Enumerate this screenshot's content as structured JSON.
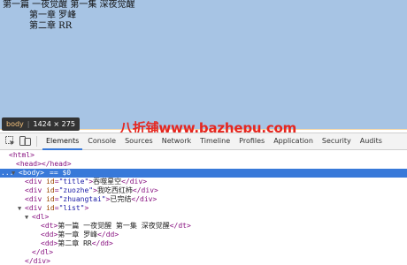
{
  "preview": {
    "dt_text": "第一篇 一夜觉醒 第一集 深夜觉醒",
    "dd_items": [
      "第一章 罗峰",
      "第二章 RR"
    ],
    "tooltip_tag": "body",
    "tooltip_size": "1424 × 275",
    "watermark": "八折铺www.bazhepu.com"
  },
  "toolbar": {
    "tabs": [
      "Elements",
      "Console",
      "Sources",
      "Network",
      "Timeline",
      "Profiles",
      "Application",
      "Security",
      "Audits"
    ],
    "active_tab": "Elements"
  },
  "dom": {
    "html_open": "<html>",
    "head": "<head></head>",
    "body_gutter": "...",
    "body_open": "<body>",
    "body_marker": "== $0",
    "div1_attr": "id",
    "div1_val": "\"title\"",
    "div1_text": "吞噬星空",
    "div2_attr": "id",
    "div2_val": "\"zuozhe\"",
    "div2_text": "我吃西红柿",
    "div3_attr": "id",
    "div3_val": "\"zhuangtai\"",
    "div3_text": "已完结",
    "div4_attr": "id",
    "div4_val": "\"list\"",
    "dl_open": "<dl>",
    "dt_text": "第一篇 一夜觉醒 第一集 深夜觉醒",
    "dd1_text": "第一章 罗峰",
    "dd2_text": "第二章 RR",
    "dl_close": "</dl>",
    "div_close": "</div>"
  },
  "colors": {
    "highlight": "#a7c4e4",
    "margin": "#f5d7a6",
    "selection": "#3879d9",
    "watermark": "#e6261f"
  }
}
